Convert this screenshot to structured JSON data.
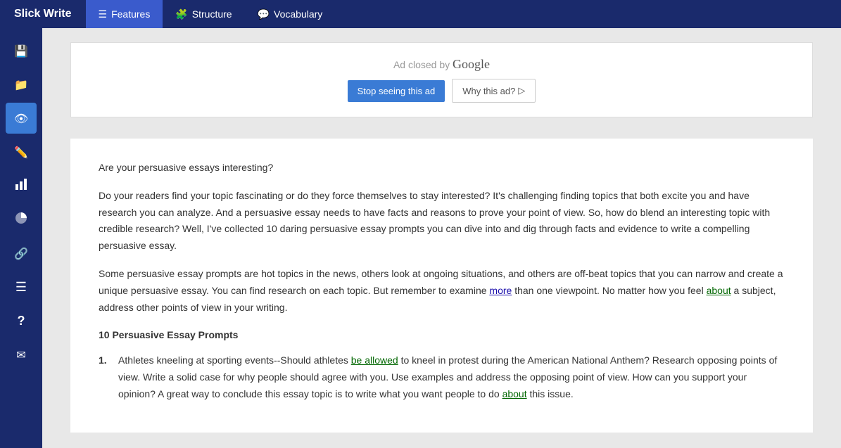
{
  "brand": "Slick Write",
  "nav": {
    "items": [
      {
        "id": "features",
        "label": "Features",
        "icon": "☰",
        "active": true
      },
      {
        "id": "structure",
        "label": "Structure",
        "icon": "🧩",
        "active": false
      },
      {
        "id": "vocabulary",
        "label": "Vocabulary",
        "icon": "💬",
        "active": false
      }
    ]
  },
  "sidebar": {
    "items": [
      {
        "id": "save",
        "icon": "save",
        "active": false
      },
      {
        "id": "folder",
        "icon": "folder",
        "active": false
      },
      {
        "id": "eye",
        "icon": "eye",
        "active": true
      },
      {
        "id": "pencil",
        "icon": "pencil",
        "active": false
      },
      {
        "id": "chart-bar",
        "icon": "chart",
        "active": false
      },
      {
        "id": "chart-pie",
        "icon": "pie",
        "active": false
      },
      {
        "id": "link",
        "icon": "link",
        "active": false
      },
      {
        "id": "list",
        "icon": "list",
        "active": false
      },
      {
        "id": "question",
        "icon": "question",
        "active": false
      },
      {
        "id": "mail",
        "icon": "mail",
        "active": false
      }
    ]
  },
  "ad": {
    "closed_text": "Ad closed by",
    "google_text": "Google",
    "stop_label": "Stop seeing this ad",
    "why_label": "Why this ad?",
    "why_icon": "▷"
  },
  "article": {
    "heading": "Are your persuasive essays interesting?",
    "para1": "Do your readers find your topic fascinating or do they force themselves to stay interested? It's challenging finding topics that both excite you and have research you can analyze.  And a persuasive essay needs to have facts and reasons to prove your point of view.  So, how do blend an interesting topic with credible research? Well, I've collected 10 daring persuasive essay prompts you can dive into and dig through facts and evidence to write a compelling persuasive essay.",
    "para2_before_more": "Some persuasive essay prompts are hot topics in the news, others look at ongoing situations, and others are off-beat topics that you can narrow and create a unique persuasive essay.  You can find research on each topic.  But remember to examine ",
    "para2_more_link": "more",
    "para2_after_more": " than one viewpoint.   No matter how you feel ",
    "para2_about_link": "about",
    "para2_end": " a subject, address other points of view in your writing.",
    "list_heading": "10 Persuasive Essay Prompts",
    "list_items": [
      {
        "num": "1.",
        "before_link": "Athletes kneeling at sporting events--Should athletes ",
        "link_text": "be allowed",
        "after_link": " to kneel in protest during the American National Anthem?  Research opposing points of view.   Write a solid case for why people should agree with you.  Use examples and address the opposing point of view.  How can you support your opinion? A great way to conclude this essay topic is to write what you want people to do ",
        "about_link": "about",
        "end_text": " this issue."
      }
    ]
  }
}
